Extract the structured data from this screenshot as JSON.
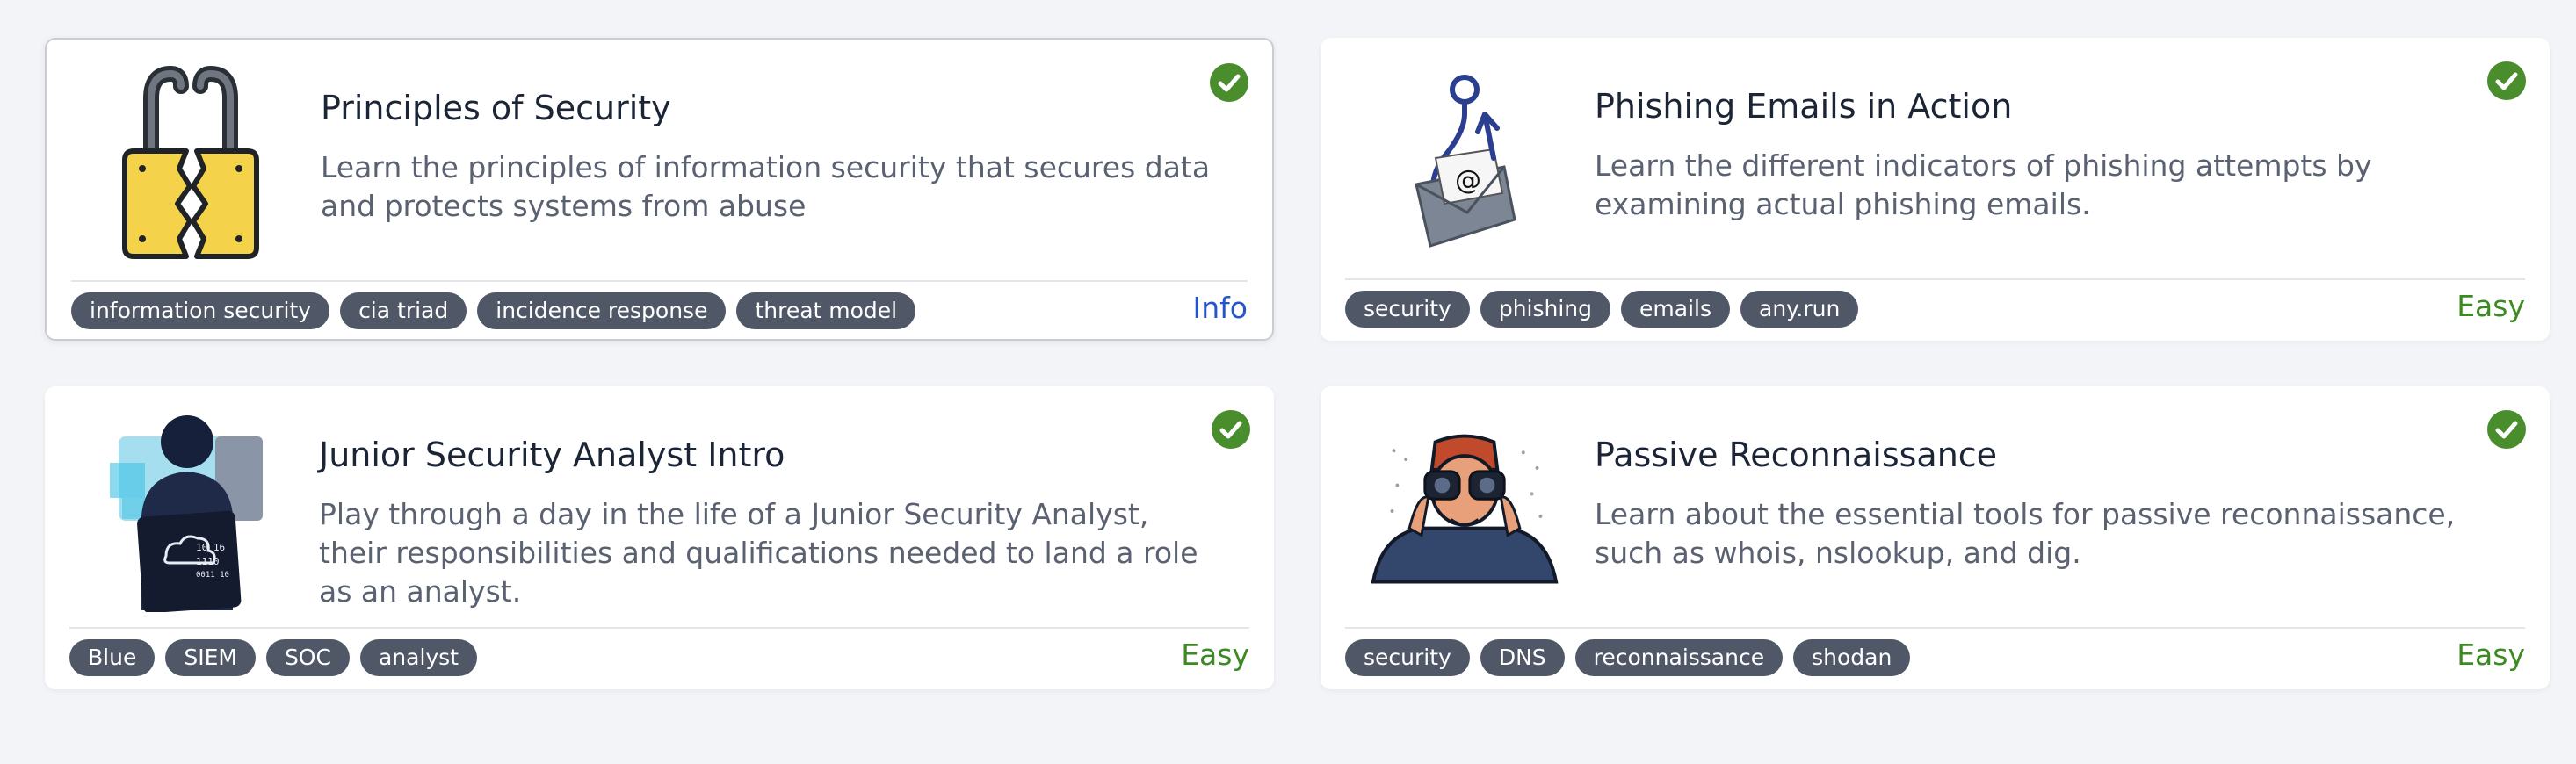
{
  "colors": {
    "tag_bg": "#505868",
    "easy": "#3c8a22",
    "info": "#2456c9",
    "check": "#4a8d2c"
  },
  "rooms": [
    {
      "title": "Principles of Security",
      "description": "Learn the principles of information security that secures data and protects systems from abuse",
      "tags": [
        "information security",
        "cia triad",
        "incidence response",
        "threat model"
      ],
      "level": "Info",
      "thumbnail": "broken-padlock-icon",
      "completed": true
    },
    {
      "title": "Phishing Emails in Action",
      "description": "Learn the different indicators of phishing attempts by examining actual phishing emails.",
      "tags": [
        "security",
        "phishing",
        "emails",
        "any.run"
      ],
      "level": "Easy",
      "thumbnail": "phishing-hook-envelope-icon",
      "completed": true
    },
    {
      "title": "Junior Security Analyst Intro",
      "description": "Play through a day in the life of a Junior Security Analyst, their responsibilities and qualifications needed to land a role as an analyst.",
      "tags": [
        "Blue",
        "SIEM",
        "SOC",
        "analyst"
      ],
      "level": "Easy",
      "thumbnail": "hooded-analyst-icon",
      "completed": true
    },
    {
      "title": "Passive Reconnaissance",
      "description": "Learn about the essential tools for passive reconnaissance, such as whois, nslookup, and dig.",
      "tags": [
        "security",
        "DNS",
        "reconnaissance",
        "shodan"
      ],
      "level": "Easy",
      "thumbnail": "binoculars-man-icon",
      "completed": true
    }
  ]
}
